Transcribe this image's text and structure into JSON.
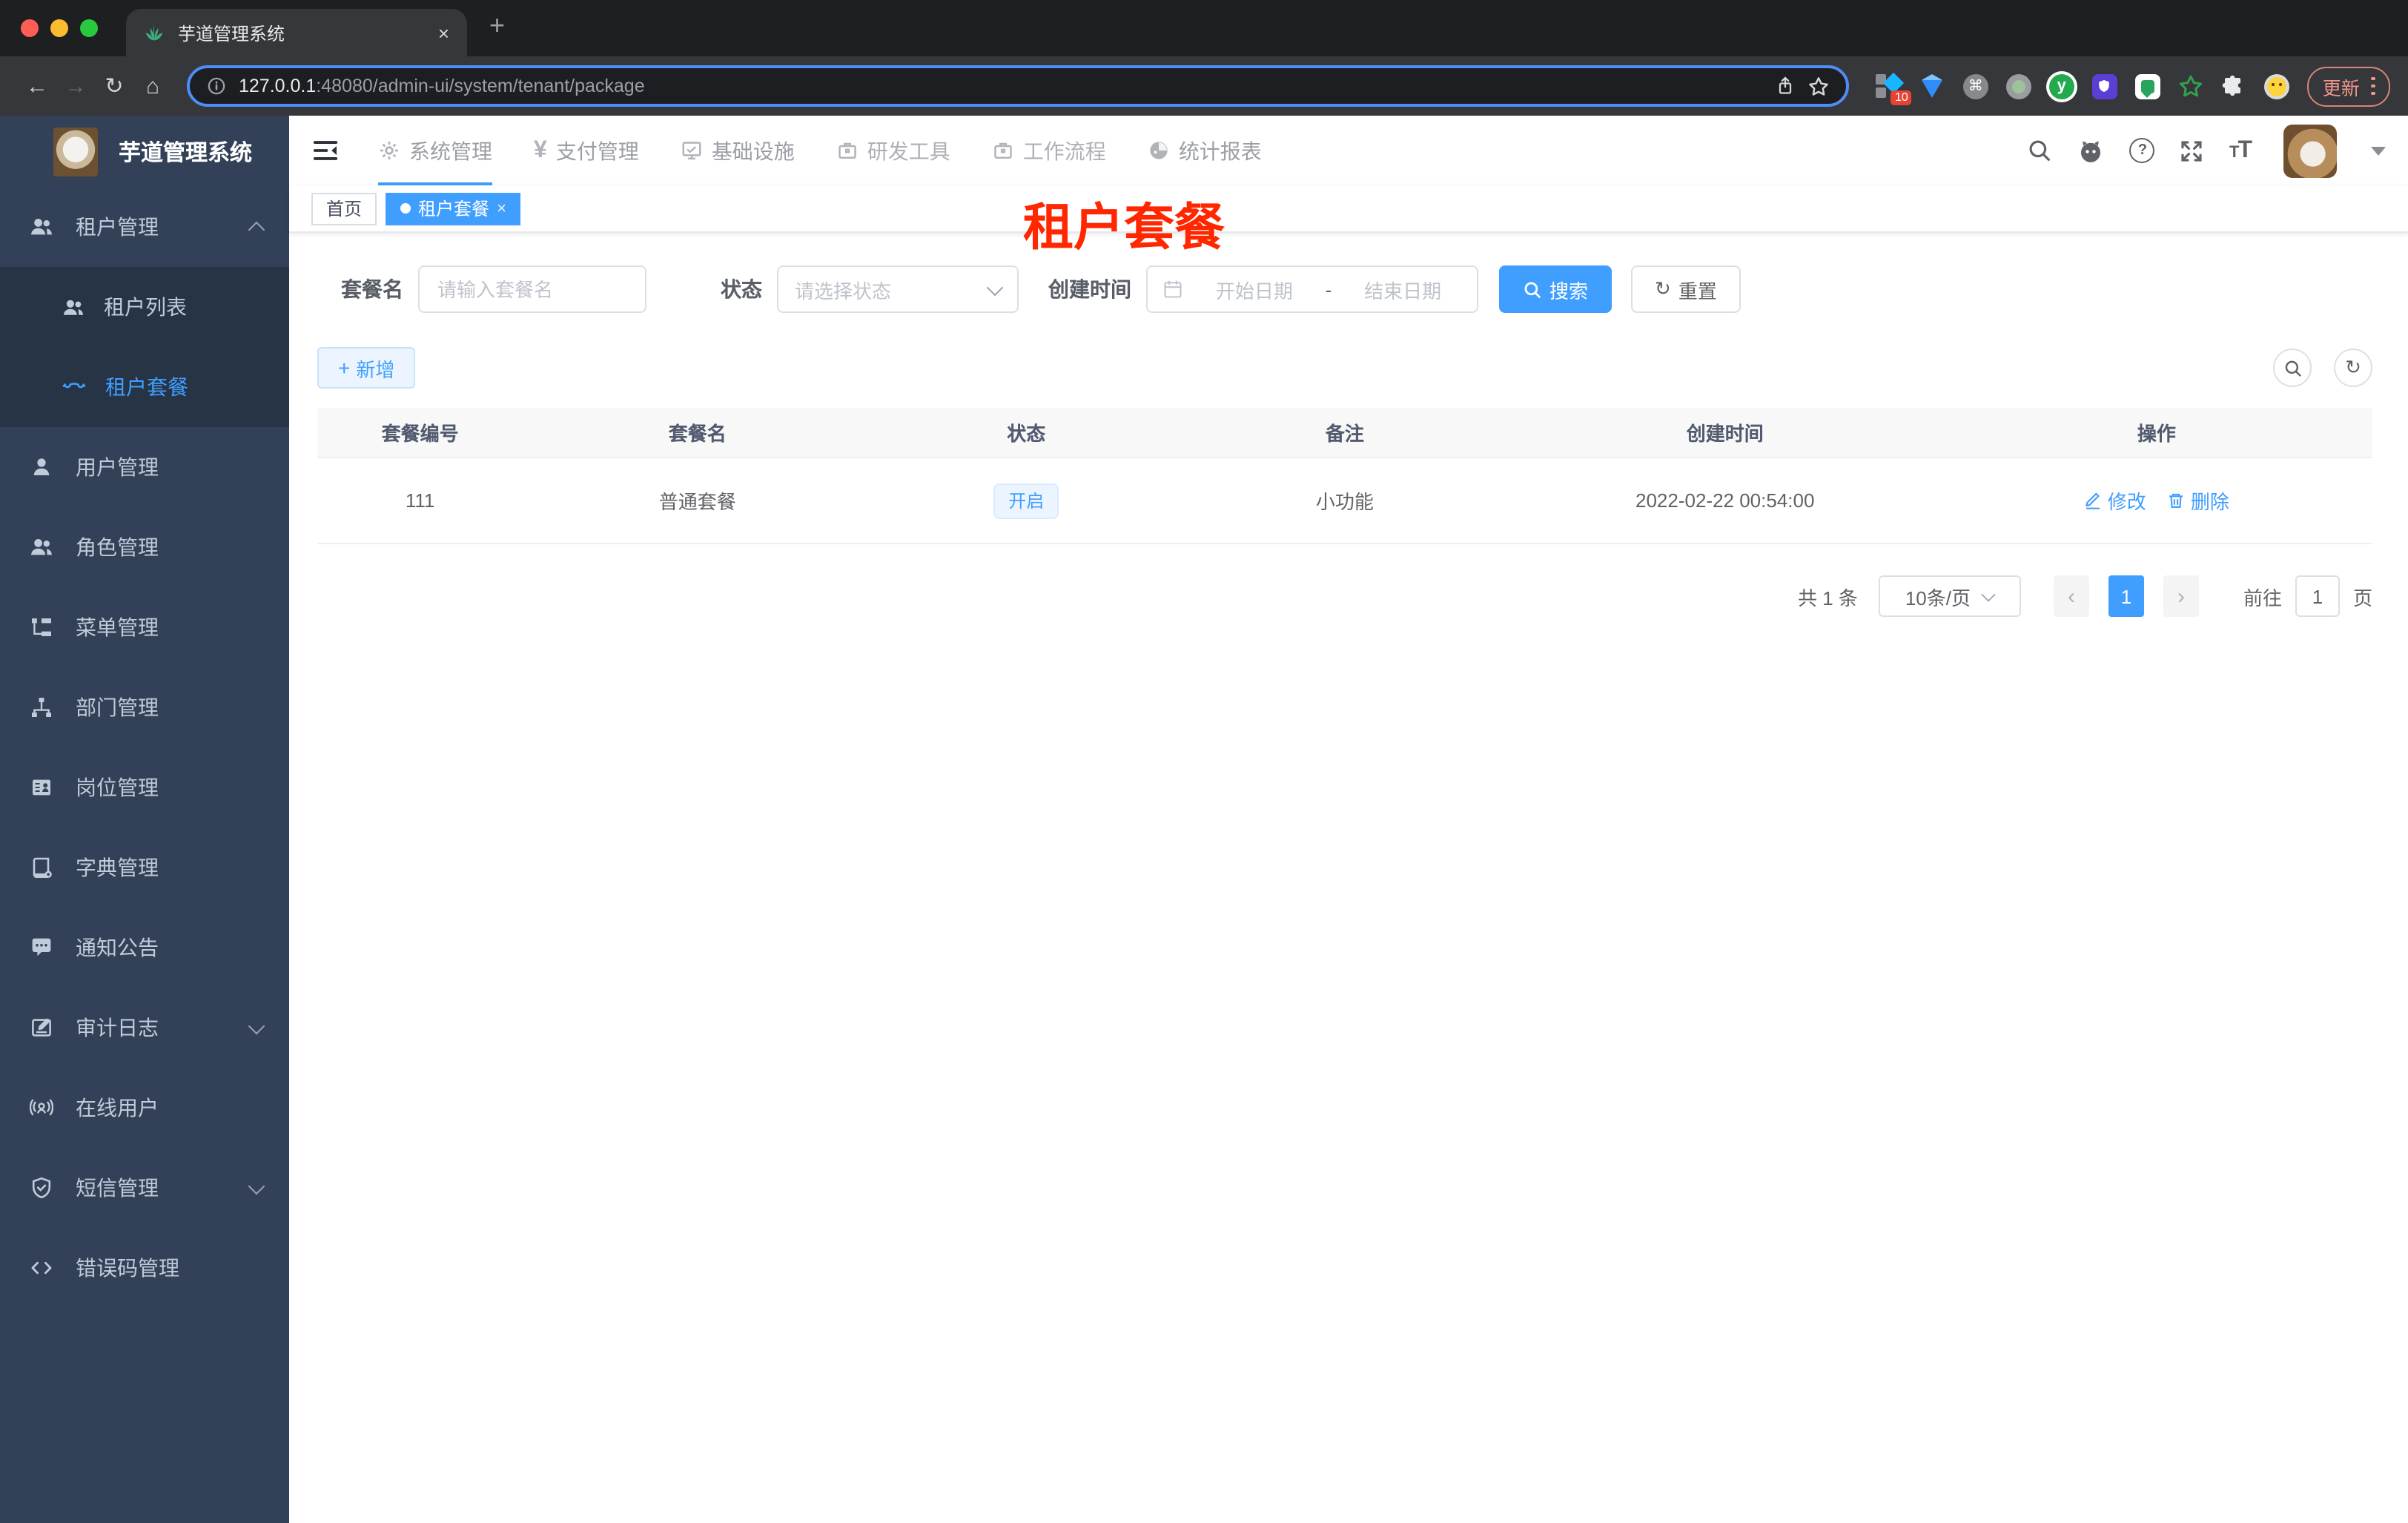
{
  "colors": {
    "accent": "#409eff",
    "annotation_red": "#ff2600",
    "sidebar_bg": "#324157",
    "submenu_bg": "#263445",
    "status_tag_bg": "#ecf5ff",
    "tab_active_bg": "#409eff"
  },
  "browser": {
    "tab": {
      "title": "芋道管理系统",
      "close": "×",
      "new_tab": "+"
    },
    "url": {
      "host": "127.0.0.1",
      "rest": ":48080/admin-ui/system/tenant/package"
    },
    "extensions_badge": "10",
    "ext_cmd_glyph": "⌘",
    "ext_y_glyph": "y",
    "update_label": "更新"
  },
  "header": {
    "nav": [
      "系统管理",
      "支付管理",
      "基础设施",
      "研发工具",
      "工作流程",
      "统计报表"
    ],
    "yen_glyph": "¥",
    "help_glyph": "?",
    "font_small": "T",
    "font_big": "T"
  },
  "sidebar": {
    "logo_title": "芋道管理系统",
    "items": [
      {
        "label": "租户管理",
        "children": [
          {
            "label": "租户列表"
          },
          {
            "label": "租户套餐"
          }
        ]
      },
      {
        "label": "用户管理"
      },
      {
        "label": "角色管理"
      },
      {
        "label": "菜单管理"
      },
      {
        "label": "部门管理"
      },
      {
        "label": "岗位管理"
      },
      {
        "label": "字典管理"
      },
      {
        "label": "通知公告"
      },
      {
        "label": "审计日志"
      },
      {
        "label": "在线用户"
      },
      {
        "label": "短信管理"
      },
      {
        "label": "错误码管理"
      }
    ]
  },
  "tags": {
    "home": "首页",
    "active": "租户套餐",
    "close_glyph": "×"
  },
  "annotation": "租户套餐",
  "filters": {
    "name_label": "套餐名",
    "name_placeholder": "请输入套餐名",
    "status_label": "状态",
    "status_placeholder": "请选择状态",
    "date_label": "创建时间",
    "date_start_placeholder": "开始日期",
    "date_separator": "-",
    "date_end_placeholder": "结束日期",
    "search_label": "搜索",
    "reset_label": "重置",
    "reset_glyph": "↻"
  },
  "toolbar": {
    "add_label": "新增",
    "add_glyph": "+",
    "refresh_glyph": "↻"
  },
  "table": {
    "headers": [
      "套餐编号",
      "套餐名",
      "状态",
      "备注",
      "创建时间",
      "操作"
    ],
    "row": {
      "id": "111",
      "name": "普通套餐",
      "status": "开启",
      "remark": "小功能",
      "created_at": "2022-02-22 00:54:00",
      "edit_label": "修改",
      "delete_label": "删除"
    }
  },
  "pagination": {
    "total": "共 1 条",
    "page_size": "10条/页",
    "page": "1",
    "prev": "‹",
    "next": "›",
    "goto_label": "前往",
    "goto_value": "1",
    "unit_label": "页"
  }
}
